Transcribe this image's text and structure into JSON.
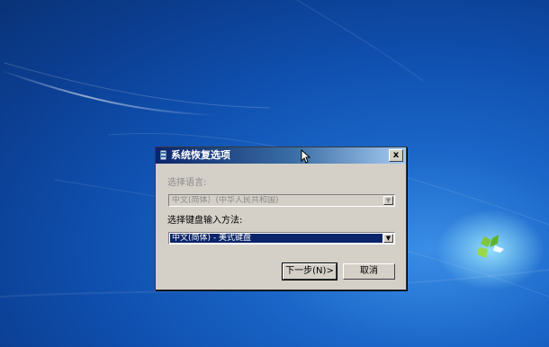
{
  "dialog": {
    "title": "系统恢复选项",
    "close_symbol": "x",
    "language_label": "选择语言:",
    "language_value": "中文(简体）(中华人民共和国)",
    "keyboard_label": "选择键盘输入方法:",
    "keyboard_value": "中文(简体) - 美式键盘",
    "next_button": "下一步(N)>",
    "cancel_button": "取消"
  },
  "icons": {
    "title_icon": "system-recovery-icon",
    "dropdown_icon": "chevron-down-icon",
    "cursor": "mouse-cursor-icon",
    "logo": "windows-logo-icon"
  },
  "colors": {
    "titlebar_start": "#0a246a",
    "titlebar_end": "#a6caf0",
    "dialog_bg": "#d4d0c8",
    "selection": "#0a246a",
    "desktop": "#1a66c8"
  }
}
